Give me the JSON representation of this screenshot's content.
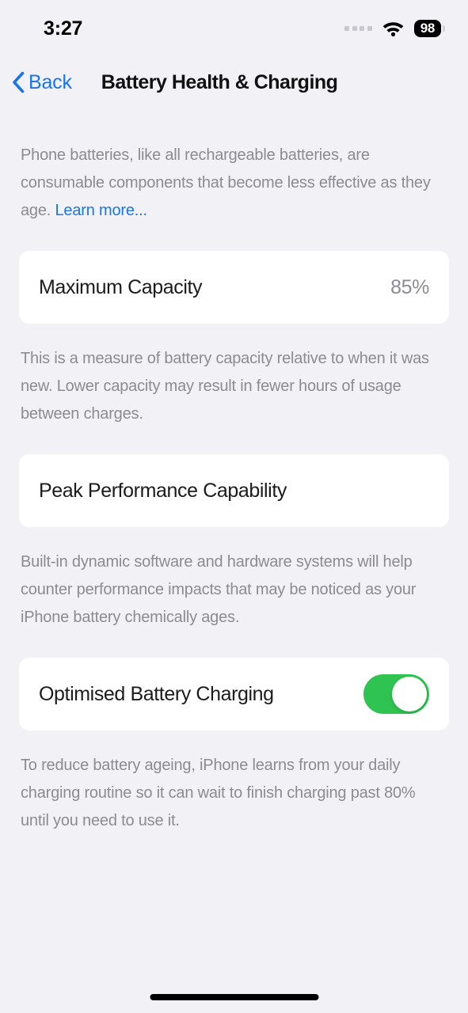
{
  "status_bar": {
    "time": "3:27",
    "signal_icon": "cellular-dots-icon",
    "wifi_icon": "wifi-icon",
    "battery_level": "98"
  },
  "nav": {
    "back_label": "Back",
    "back_icon": "chevron-left-icon",
    "title": "Battery Health & Charging"
  },
  "intro": {
    "text": "Phone batteries, like all rechargeable batteries, are consumable components that become less effective as they age. ",
    "link_label": "Learn more..."
  },
  "maximum_capacity": {
    "label": "Maximum Capacity",
    "value": "85%",
    "description": "This is a measure of battery capacity relative to when it was new. Lower capacity may result in fewer hours of usage between charges."
  },
  "peak_performance": {
    "label": "Peak Performance Capability",
    "description": "Built-in dynamic software and hardware systems will help counter performance impacts that may be noticed as your iPhone battery chemically ages."
  },
  "optimised_charging": {
    "label": "Optimised Battery Charging",
    "toggle_state": "on",
    "description": "To reduce battery ageing, iPhone learns from your daily charging routine so it can wait to finish charging past 80% until you need to use it."
  },
  "colors": {
    "background": "#f1f1f6",
    "card": "#ffffff",
    "accent_blue": "#1a76e8",
    "toggle_green": "#2fc452",
    "secondary_text": "#8b8b92"
  },
  "home_indicator": "home-indicator"
}
